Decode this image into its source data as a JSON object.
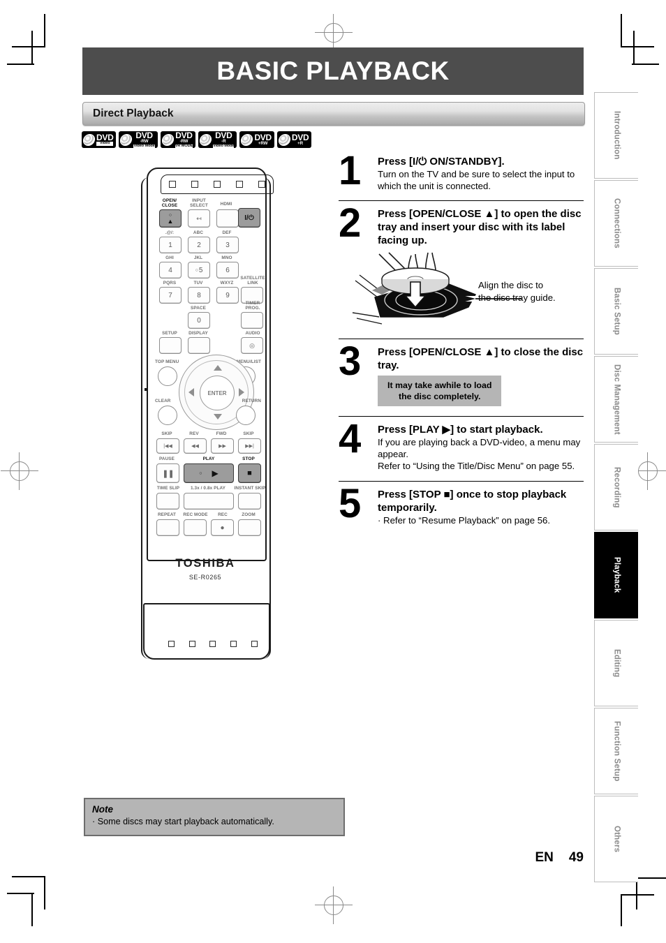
{
  "header": {
    "title": "BASIC PLAYBACK"
  },
  "section": {
    "title": "Direct Playback"
  },
  "badges": [
    {
      "name": "dvd-video",
      "line1": "DVD",
      "line2": "",
      "line3": "Video"
    },
    {
      "name": "dvd-rw-video-mode",
      "line1": "DVD",
      "line2": "-RW",
      "line3": "Video Mode"
    },
    {
      "name": "dvd-rw-vr-mode",
      "line1": "DVD",
      "line2": "-RW",
      "line3": "VR MODE"
    },
    {
      "name": "dvd-r-video-mode",
      "line1": "DVD",
      "line2": "-R",
      "line3": "Video Mode"
    },
    {
      "name": "dvd-plus-rw",
      "line1": "DVD",
      "line2": "+RW",
      "line3": ""
    },
    {
      "name": "dvd-plus-r",
      "line1": "DVD",
      "line2": "+R",
      "line3": ""
    }
  ],
  "remote": {
    "brand": "TOSHIBA",
    "model": "SE-R0265",
    "labels": {
      "open_close": "OPEN/\nCLOSE",
      "input_select": "INPUT\nSELECT",
      "hdmi": "HDMI",
      "key1_letters": ".@/:",
      "key2_letters": "ABC",
      "key3_letters": "DEF",
      "key4_letters": "GHI",
      "key5_letters": "JKL",
      "key6_letters": "MNO",
      "key7_letters": "PQRS",
      "key8_letters": "TUV",
      "key9_letters": "WXYZ",
      "key0_letters": "SPACE",
      "satellite_link": "SATELLITE\nLINK",
      "timer_prog": "TIMER\nPROG.",
      "setup": "SETUP",
      "display": "DISPLAY",
      "audio": "AUDIO",
      "top_menu": "TOP MENU",
      "menu_list": "MENU/LIST",
      "clear": "CLEAR",
      "return": "RETURN",
      "enter": "ENTER",
      "skip_back": "SKIP",
      "rev": "REV",
      "fwd": "FWD",
      "skip_fwd": "SKIP",
      "pause": "PAUSE",
      "play": "PLAY",
      "stop": "STOP",
      "time_slip": "TIME SLIP",
      "speed_play": "1.3x / 0.8x PLAY",
      "instant_skip": "INSTANT SKIP",
      "repeat": "REPEAT",
      "rec_mode": "REC MODE",
      "rec": "REC",
      "zoom": "ZOOM"
    },
    "keys": {
      "k1": "1",
      "k2": "2",
      "k3": "3",
      "k4": "4",
      "k5": "5",
      "k6": "6",
      "k7": "7",
      "k8": "8",
      "k9": "9",
      "k0": "0"
    },
    "glyphs": {
      "power": "I/⏻",
      "eject": "▲",
      "input": "↦",
      "audio": "◎",
      "play": "▶",
      "stop": "■",
      "pause": "‖",
      "rec": "●",
      "skip_back": "|◀◀",
      "skip_fwd": "▶▶|",
      "rev": "◀◀",
      "fwd": "▶▶"
    }
  },
  "steps": [
    {
      "number": "1",
      "heading": "Press [I/⏻ ON/STANDBY].",
      "body": "Turn on the TV and be sure to select the input to which the unit is connected."
    },
    {
      "number": "2",
      "heading": "Press [OPEN/CLOSE ▲] to open the disc tray and insert your disc with its label facing up.",
      "body": "",
      "figure_caption": "Align the disc to\nthe disc tray guide."
    },
    {
      "number": "3",
      "heading": "Press [OPEN/CLOSE ▲] to close the disc tray.",
      "callout": "It may take awhile to load\nthe disc completely."
    },
    {
      "number": "4",
      "heading": "Press [PLAY ▶] to start playback.",
      "body": "If you are playing back a DVD-video, a menu may appear.",
      "body2": "Refer to “Using the Title/Disc Menu” on page 55."
    },
    {
      "number": "5",
      "heading": "Press [STOP ■] once to stop playback temporarily.",
      "body": "· Refer to “Resume Playback” on page 56."
    }
  ],
  "note": {
    "title": "Note",
    "body": "· Some discs may start playback automatically."
  },
  "footer": {
    "lang": "EN",
    "page": "49"
  },
  "tabs": [
    {
      "label": "Introduction",
      "active": false
    },
    {
      "label": "Connections",
      "active": false
    },
    {
      "label": "Basic Setup",
      "active": false
    },
    {
      "label": "Disc Management",
      "active": false
    },
    {
      "label": "Recording",
      "active": false
    },
    {
      "label": "Playback",
      "active": true
    },
    {
      "label": "Editing",
      "active": false
    },
    {
      "label": "Function Setup",
      "active": false
    },
    {
      "label": "Others",
      "active": false
    }
  ],
  "colors": {
    "banner": "#4d4d4d",
    "callout": "#b5b5b5",
    "active_tab": "#000000"
  }
}
